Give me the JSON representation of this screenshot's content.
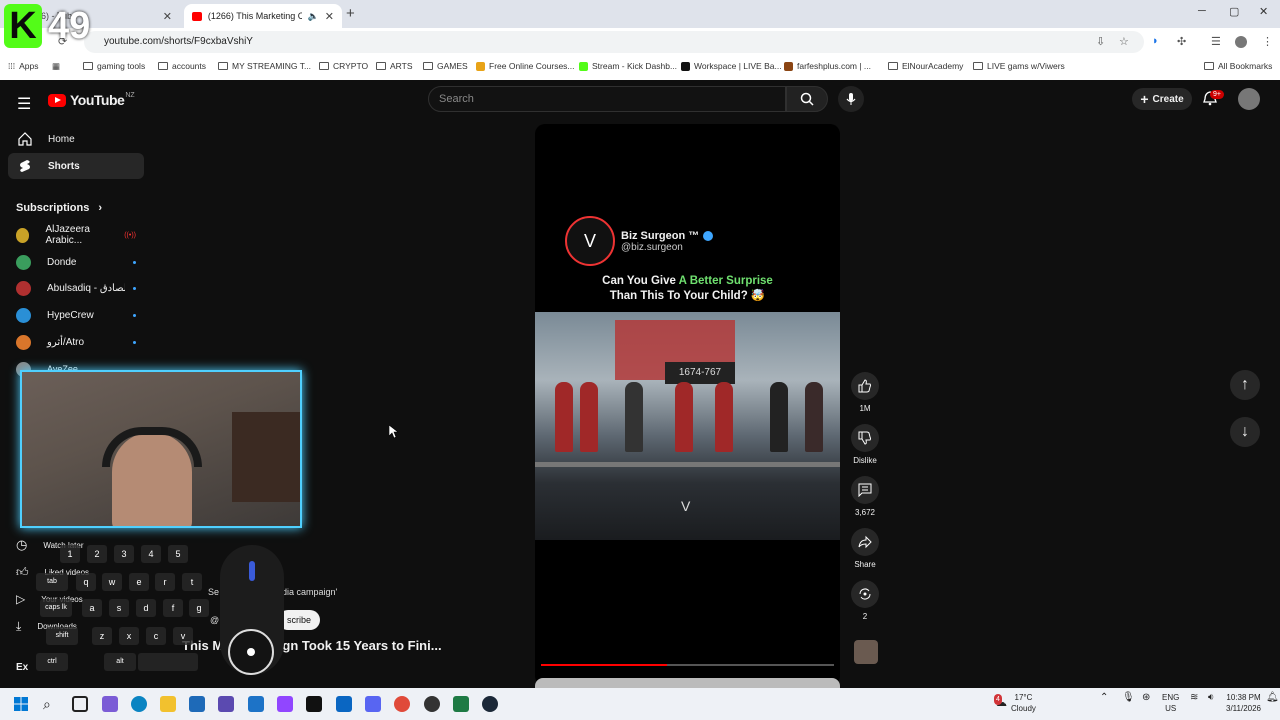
{
  "browser": {
    "tabs": [
      {
        "label": "(126) - Tube",
        "active": false
      },
      {
        "label": "(1266) This Marketing Camp",
        "active": true
      }
    ],
    "url": "youtube.com/shorts/F9cxbaVshiY",
    "bookmarks": [
      "Apps",
      "gaming tools",
      "accounts",
      "MY STREAMING T...",
      "CRYPTO",
      "ARTS",
      "GAMES",
      "Free Online Courses...",
      "Stream - Kick Dashb...",
      "Workspace | LIVE Ba...",
      "farfeshplus.com | ...",
      "ElNourAcademy",
      "LIVE gams w/Viwers",
      "All Bookmarks"
    ]
  },
  "stream_badge": {
    "letter": "K",
    "number": "49"
  },
  "youtube": {
    "logo_text": "YouTube",
    "region": "NZ",
    "search_placeholder": "Search",
    "create_label": "Create",
    "notif_count": "9+",
    "sidebar": {
      "nav": [
        {
          "label": "Home",
          "icon": "home-icon"
        },
        {
          "label": "Shorts",
          "icon": "shorts-icon"
        }
      ],
      "subscriptions_label": "Subscriptions",
      "subs": [
        {
          "name": "AlJazeera Arabic...",
          "color": "#c9a227"
        },
        {
          "name": "Donde",
          "color": "#3a9d5d"
        },
        {
          "name": "Abulsadiq - الصادق",
          "color": "#b03030"
        },
        {
          "name": "HypeCrew",
          "color": "#2a8fd6"
        },
        {
          "name": "أثرو/Atro",
          "color": "#d9762b"
        },
        {
          "name": "AyeZee",
          "color": "#888888"
        }
      ],
      "lower": [
        "Watch later",
        "Liked videos",
        "Your videos",
        "Downloads"
      ]
    },
    "video": {
      "channel_name": "Biz Surgeon ™",
      "channel_handle": "@biz.surgeon",
      "caption_pre": "Can You Give ",
      "caption_hl": "A Better Surprise",
      "caption_post": "Than This To Your Child? 🤯",
      "board_text": "1674-767",
      "progress": 0.43
    },
    "actions": [
      {
        "label": "1M",
        "icon": "like-icon"
      },
      {
        "label": "Dislike",
        "icon": "dislike-icon"
      },
      {
        "label": "3,672",
        "icon": "comments-icon"
      },
      {
        "label": "Share",
        "icon": "share-icon"
      },
      {
        "label": "2",
        "icon": "remix-icon"
      }
    ],
    "under": {
      "search_hint": "dia campaign'",
      "subscribe": "scribe",
      "title": "This M      ampaign Took 15 Years to Fini...",
      "se": "Se",
      "at": "@"
    },
    "explore_label": "Ex"
  },
  "keys": [
    "1",
    "2",
    "3",
    "4",
    "5",
    "tab",
    "q",
    "w",
    "e",
    "r",
    "t",
    "caps lk",
    "a",
    "s",
    "d",
    "f",
    "g",
    "shift",
    "z",
    "x",
    "c",
    "v",
    "ctrl",
    "alt"
  ],
  "taskbar": {
    "weather_temp": "17°C",
    "weather_desc": "Cloudy",
    "weather_badge": "4",
    "lang_top": "ENG",
    "lang_bottom": "US",
    "time": "10:38 PM",
    "date": "3/11/2026"
  }
}
